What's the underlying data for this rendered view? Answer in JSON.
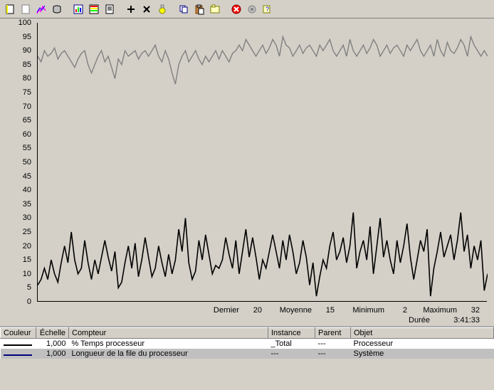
{
  "toolbar": {
    "icons": [
      "new",
      "blank",
      "counter",
      "cylinder",
      "view-chart",
      "view-report",
      "view-log",
      "add",
      "delete",
      "highlight",
      "copy",
      "paste",
      "properties",
      "stop",
      "freeze",
      "help"
    ]
  },
  "chart_data": {
    "type": "line",
    "ylim": [
      0,
      100
    ],
    "yticks": [
      0,
      5,
      10,
      15,
      20,
      25,
      30,
      35,
      40,
      45,
      50,
      55,
      60,
      65,
      70,
      75,
      80,
      85,
      90,
      95,
      100
    ],
    "series": [
      {
        "name": "% Temps processeur",
        "color": "#000000",
        "values": [
          6,
          8,
          12,
          8,
          15,
          10,
          7,
          14,
          20,
          14,
          25,
          15,
          10,
          12,
          22,
          14,
          8,
          15,
          10,
          16,
          22,
          16,
          11,
          18,
          5,
          7,
          14,
          20,
          12,
          21,
          9,
          15,
          23,
          16,
          9,
          12,
          20,
          14,
          9,
          17,
          10,
          15,
          26,
          18,
          30,
          14,
          8,
          11,
          22,
          15,
          24,
          17,
          10,
          13,
          12,
          15,
          23,
          17,
          12,
          22,
          10,
          18,
          26,
          16,
          23,
          16,
          8,
          15,
          12,
          18,
          24,
          18,
          12,
          22,
          15,
          24,
          18,
          10,
          14,
          22,
          16,
          6,
          14,
          2,
          9,
          15,
          12,
          20,
          25,
          15,
          18,
          23,
          14,
          20,
          32,
          12,
          18,
          22,
          15,
          27,
          10,
          20,
          30,
          16,
          22,
          15,
          10,
          22,
          14,
          20,
          28,
          16,
          8,
          15,
          22,
          18,
          26,
          2,
          12,
          18,
          25,
          16,
          20,
          24,
          15,
          22,
          32,
          18,
          24,
          12,
          20,
          15,
          22,
          4,
          10
        ]
      },
      {
        "name": "Longueur de la file du processeur",
        "color": "#808080",
        "values": [
          88,
          86,
          90,
          88,
          89,
          91,
          87,
          89,
          90,
          88,
          86,
          84,
          87,
          89,
          90,
          85,
          82,
          85,
          88,
          90,
          86,
          88,
          84,
          80,
          87,
          85,
          90,
          88,
          89,
          90,
          87,
          89,
          90,
          88,
          90,
          92,
          88,
          86,
          90,
          87,
          82,
          78,
          85,
          88,
          90,
          86,
          88,
          90,
          87,
          85,
          88,
          86,
          88,
          90,
          87,
          90,
          88,
          86,
          89,
          90,
          92,
          90,
          94,
          92,
          90,
          88,
          90,
          92,
          89,
          91,
          94,
          92,
          88,
          95,
          92,
          91,
          88,
          90,
          92,
          89,
          91,
          92,
          90,
          88,
          92,
          90,
          92,
          94,
          90,
          88,
          90,
          92,
          88,
          94,
          90,
          88,
          90,
          92,
          89,
          91,
          94,
          92,
          88,
          90,
          92,
          89,
          91,
          92,
          90,
          88,
          92,
          90,
          92,
          94,
          90,
          88,
          90,
          92,
          88,
          94,
          90,
          88,
          93,
          90,
          89,
          91,
          94,
          92,
          88,
          95,
          92,
          90,
          88,
          90,
          88
        ]
      }
    ]
  },
  "stats": {
    "last_label": "Dernier",
    "last": "20",
    "avg_label": "Moyenne",
    "avg": "15",
    "min_label": "Minimum",
    "min": "2",
    "max_label": "Maximum",
    "max": "32",
    "dur_label": "Durée",
    "dur": "3:41:33"
  },
  "table": {
    "headers": {
      "couleur": "Couleur",
      "echelle": "Échelle",
      "compteur": "Compteur",
      "instance": "Instance",
      "parent": "Parent",
      "objet": "Objet"
    },
    "rows": [
      {
        "color": "#000000",
        "echelle": "1,000",
        "compteur": "% Temps processeur",
        "instance": "_Total",
        "parent": "---",
        "objet": "Processeur",
        "selected": false
      },
      {
        "color": "#000080",
        "echelle": "1,000",
        "compteur": "Longueur de la file du processeur",
        "instance": "---",
        "parent": "---",
        "objet": "Système",
        "selected": true
      }
    ]
  }
}
